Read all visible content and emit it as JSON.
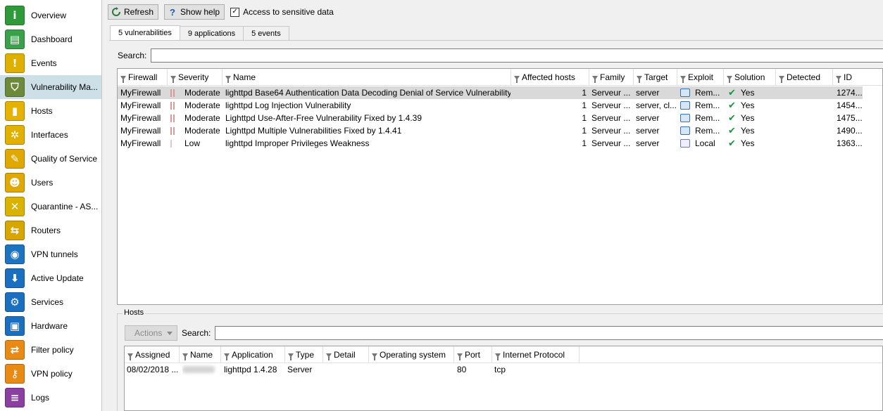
{
  "sidebar": {
    "items": [
      {
        "label": "Overview",
        "icon": "info-icon",
        "color": "#2e9a3a",
        "glyph": "i"
      },
      {
        "label": "Dashboard",
        "icon": "dashboard-icon",
        "color": "#3aa04a",
        "glyph": "▤"
      },
      {
        "label": "Events",
        "icon": "alert-icon",
        "color": "#e0b000",
        "glyph": "!"
      },
      {
        "label": "Vulnerability Ma...",
        "icon": "shield-icon",
        "color": "#6c8a3a",
        "glyph": "⛉",
        "selected": true
      },
      {
        "label": "Hosts",
        "icon": "hosts-icon",
        "color": "#e5b200",
        "glyph": "▮"
      },
      {
        "label": "Interfaces",
        "icon": "interfaces-icon",
        "color": "#e2b100",
        "glyph": "✲"
      },
      {
        "label": "Quality of Service",
        "icon": "qos-icon",
        "color": "#e0a800",
        "glyph": "✎"
      },
      {
        "label": "Users",
        "icon": "users-icon",
        "color": "#e0a800",
        "glyph": "☻"
      },
      {
        "label": "Quarantine - AS...",
        "icon": "quarantine-icon",
        "color": "#d9b300",
        "glyph": "✕"
      },
      {
        "label": "Routers",
        "icon": "routers-icon",
        "color": "#d7a600",
        "glyph": "⇆"
      },
      {
        "label": "VPN tunnels",
        "icon": "vpn-tunnel-icon",
        "color": "#1b73c2",
        "glyph": "◉"
      },
      {
        "label": "Active Update",
        "icon": "download-icon",
        "color": "#1b6fc0",
        "glyph": "⬇"
      },
      {
        "label": "Services",
        "icon": "services-icon",
        "color": "#1b6fc0",
        "glyph": "⚙"
      },
      {
        "label": "Hardware",
        "icon": "hardware-icon",
        "color": "#1b6fc0",
        "glyph": "▣"
      },
      {
        "label": "Filter policy",
        "icon": "filter-policy-icon",
        "color": "#e88a14",
        "glyph": "⇄"
      },
      {
        "label": "VPN policy",
        "icon": "vpn-policy-icon",
        "color": "#e88a14",
        "glyph": "⚷"
      },
      {
        "label": "Logs",
        "icon": "logs-icon",
        "color": "#8b3fa0",
        "glyph": "≡"
      }
    ]
  },
  "toolbar": {
    "refresh_label": "Refresh",
    "help_label": "Show help",
    "sensitive_label": "Access to sensitive data",
    "sensitive_checked": true
  },
  "tabs": [
    {
      "label": "5 vulnerabilities",
      "active": true
    },
    {
      "label": "9 applications",
      "active": false
    },
    {
      "label": "5 events",
      "active": false
    }
  ],
  "vuln_search": {
    "label": "Search:",
    "value": ""
  },
  "vuln_columns": [
    "Firewall",
    "Severity",
    "Name",
    "Affected hosts",
    "Family",
    "Target",
    "Exploit",
    "Solution",
    "Detected",
    "ID"
  ],
  "vuln_rows": [
    {
      "firewall": "MyFirewall",
      "severity": "Moderate",
      "name": "lighttpd Base64 Authentication Data Decoding Denial of Service Vulnerability",
      "hosts": "1",
      "family": "Serveur ...",
      "target": "server",
      "exploit": "Rem...",
      "solution": "Yes",
      "detected": "",
      "id": "1274...",
      "selected": true
    },
    {
      "firewall": "MyFirewall",
      "severity": "Moderate",
      "name": "lighttpd Log Injection Vulnerability",
      "hosts": "1",
      "family": "Serveur ...",
      "target": "server, cl...",
      "exploit": "Rem...",
      "solution": "Yes",
      "detected": "",
      "id": "1454..."
    },
    {
      "firewall": "MyFirewall",
      "severity": "Moderate",
      "name": "Lighttpd Use-After-Free Vulnerability Fixed by 1.4.39",
      "hosts": "1",
      "family": "Serveur ...",
      "target": "server",
      "exploit": "Rem...",
      "solution": "Yes",
      "detected": "",
      "id": "1475..."
    },
    {
      "firewall": "MyFirewall",
      "severity": "Moderate",
      "name": "Lighttpd Multiple Vulnerabilities Fixed by 1.4.41",
      "hosts": "1",
      "family": "Serveur ...",
      "target": "server",
      "exploit": "Rem...",
      "solution": "Yes",
      "detected": "",
      "id": "1490..."
    },
    {
      "firewall": "MyFirewall",
      "severity": "Low",
      "name": "lighttpd Improper Privileges Weakness",
      "hosts": "1",
      "family": "Serveur ...",
      "target": "server",
      "exploit": "Local",
      "solution": "Yes",
      "detected": "",
      "id": "1363..."
    }
  ],
  "hosts_section": {
    "title": "Hosts",
    "actions_label": "Actions",
    "search_label": "Search:",
    "search_value": "",
    "columns": [
      "Assigned",
      "Name",
      "Application",
      "Type",
      "Detail",
      "Operating system",
      "Port",
      "Internet Protocol"
    ],
    "rows": [
      {
        "assigned": "08/02/2018 ...",
        "name": "",
        "application": "lighttpd 1.4.28",
        "type": "Server",
        "detail": "",
        "os": "",
        "port": "80",
        "protocol": "tcp"
      }
    ]
  }
}
